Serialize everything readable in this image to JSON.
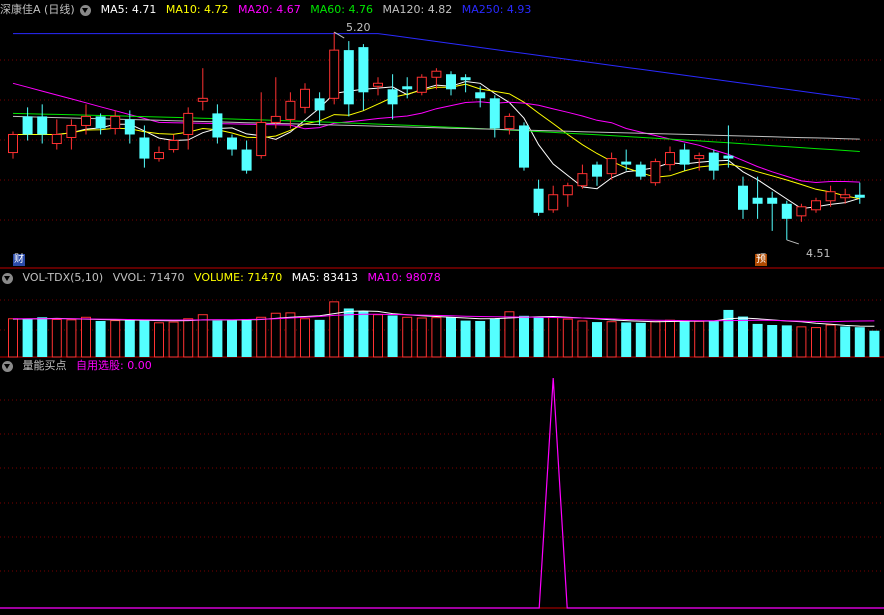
{
  "colors": {
    "up": "#ff3232",
    "down": "#54ffff",
    "ma5": "#ffffff",
    "ma10": "#ffff00",
    "ma20": "#ff00ff",
    "ma60": "#00e600",
    "ma120": "#c0c0c0",
    "ma250": "#2a2aff",
    "grid": "#7a0000",
    "signal": "#ff00ff"
  },
  "header": {
    "title": "深康佳A (日线)",
    "ma5": "MA5: 4.71",
    "ma10": "MA10: 4.72",
    "ma20": "MA20: 4.67",
    "ma60": "MA60: 4.76",
    "ma120": "MA120: 4.82",
    "ma250": "MA250: 4.93"
  },
  "vol_header": {
    "name": "VOL-TDX(5,10)",
    "vvol": "VVOL: 71470",
    "volume": "VOLUME: 71470",
    "ma5": "MA5: 83413",
    "ma10": "MA10: 98078"
  },
  "ind_header": {
    "name": "量能买点",
    "label": "自用选股: 0.00"
  },
  "markers": {
    "high_label": "5.20",
    "low_label": "4.51",
    "tag_cai": "财",
    "tag_yu": "预"
  },
  "chart_data": {
    "type": "candlestick",
    "price_range": [
      4.45,
      5.24
    ],
    "high_point": 5.2,
    "low_point": 4.51,
    "candles": [
      [
        4.8,
        4.86,
        4.78,
        4.87
      ],
      [
        4.92,
        4.86,
        4.84,
        4.95
      ],
      [
        4.92,
        4.86,
        4.83,
        4.96
      ],
      [
        4.83,
        4.86,
        4.81,
        4.91
      ],
      [
        4.85,
        4.89,
        4.81,
        4.91
      ],
      [
        4.89,
        4.92,
        4.86,
        4.96
      ],
      [
        4.92,
        4.88,
        4.86,
        4.93
      ],
      [
        4.88,
        4.92,
        4.86,
        4.94
      ],
      [
        4.91,
        4.86,
        4.83,
        4.94
      ],
      [
        4.85,
        4.78,
        4.75,
        4.89
      ],
      [
        4.78,
        4.8,
        4.77,
        4.82
      ],
      [
        4.81,
        4.84,
        4.8,
        4.86
      ],
      [
        4.86,
        4.93,
        4.81,
        4.95
      ],
      [
        4.97,
        4.98,
        4.94,
        5.08
      ],
      [
        4.93,
        4.85,
        4.83,
        4.96
      ],
      [
        4.85,
        4.81,
        4.79,
        4.86
      ],
      [
        4.81,
        4.74,
        4.73,
        4.84
      ],
      [
        4.79,
        4.9,
        4.78,
        5.0
      ],
      [
        4.9,
        4.92,
        4.88,
        5.05
      ],
      [
        4.91,
        4.97,
        4.88,
        5.0
      ],
      [
        4.95,
        5.01,
        4.93,
        5.03
      ],
      [
        4.98,
        4.94,
        4.89,
        5.0
      ],
      [
        4.98,
        5.14,
        4.96,
        5.2
      ],
      [
        5.14,
        4.96,
        4.92,
        5.17
      ],
      [
        5.15,
        5.0,
        4.94,
        5.16
      ],
      [
        5.02,
        5.03,
        4.99,
        5.05
      ],
      [
        5.01,
        4.96,
        4.91,
        5.06
      ],
      [
        5.02,
        5.01,
        4.98,
        5.05
      ],
      [
        5.0,
        5.05,
        4.99,
        5.06
      ],
      [
        5.05,
        5.07,
        5.01,
        5.08
      ],
      [
        5.06,
        5.01,
        4.99,
        5.07
      ],
      [
        5.05,
        5.04,
        5.0,
        5.06
      ],
      [
        5.0,
        4.98,
        4.95,
        5.02
      ],
      [
        4.98,
        4.88,
        4.85,
        4.99
      ],
      [
        4.88,
        4.92,
        4.86,
        4.93
      ],
      [
        4.89,
        4.75,
        4.74,
        4.9
      ],
      [
        4.68,
        4.6,
        4.59,
        4.71
      ],
      [
        4.61,
        4.66,
        4.6,
        4.69
      ],
      [
        4.66,
        4.69,
        4.62,
        4.7
      ],
      [
        4.69,
        4.73,
        4.68,
        4.76
      ],
      [
        4.76,
        4.72,
        4.69,
        4.77
      ],
      [
        4.73,
        4.78,
        4.71,
        4.8
      ],
      [
        4.77,
        4.76,
        4.74,
        4.81
      ],
      [
        4.76,
        4.72,
        4.71,
        4.77
      ],
      [
        4.7,
        4.77,
        4.69,
        4.78
      ],
      [
        4.76,
        4.8,
        4.74,
        4.82
      ],
      [
        4.81,
        4.76,
        4.74,
        4.83
      ],
      [
        4.78,
        4.79,
        4.74,
        4.8
      ],
      [
        4.8,
        4.74,
        4.71,
        4.81
      ],
      [
        4.79,
        4.78,
        4.75,
        4.89
      ],
      [
        4.69,
        4.61,
        4.58,
        4.72
      ],
      [
        4.65,
        4.63,
        4.58,
        4.72
      ],
      [
        4.65,
        4.63,
        4.54,
        4.67
      ],
      [
        4.63,
        4.58,
        4.51,
        4.64
      ],
      [
        4.59,
        4.62,
        4.57,
        4.63
      ],
      [
        4.61,
        4.64,
        4.6,
        4.65
      ],
      [
        4.64,
        4.67,
        4.62,
        4.69
      ],
      [
        4.65,
        4.66,
        4.63,
        4.68
      ],
      [
        4.66,
        4.65,
        4.63,
        4.7
      ]
    ],
    "volumes": [
      104000,
      103000,
      108000,
      102000,
      101000,
      108000,
      98000,
      99000,
      100000,
      101000,
      93000,
      95000,
      104000,
      115000,
      99000,
      100000,
      103000,
      108000,
      119000,
      120000,
      104000,
      101000,
      150000,
      132000,
      125000,
      115000,
      113000,
      108000,
      106000,
      107000,
      108000,
      99000,
      98000,
      105000,
      123000,
      112000,
      109000,
      108000,
      103000,
      98000,
      95000,
      96000,
      94000,
      93000,
      96000,
      100000,
      98000,
      97000,
      99000,
      128000,
      110000,
      90000,
      87000,
      86000,
      82000,
      80000,
      87000,
      83000,
      81000,
      71470
    ],
    "vol_up": [
      1,
      0,
      0,
      1,
      1,
      1,
      0,
      1,
      0,
      0,
      1,
      1,
      1,
      1,
      0,
      0,
      0,
      1,
      1,
      1,
      1,
      0,
      1,
      0,
      0,
      1,
      0,
      1,
      1,
      1,
      0,
      0,
      0,
      0,
      1,
      0,
      0,
      1,
      1,
      1,
      0,
      1,
      0,
      0,
      1,
      1,
      0,
      1,
      0,
      0,
      0,
      0,
      0,
      0,
      1,
      1,
      1,
      0,
      0,
      0
    ],
    "vol_ma5": [
      103000,
      103500,
      104000,
      105000,
      104000,
      103000,
      102000,
      101000,
      100500,
      100000,
      99000,
      98500,
      99000,
      101000,
      101000,
      100500,
      101000,
      102000,
      105000,
      108000,
      110000,
      112000,
      118000,
      124000,
      125000,
      124000,
      118000,
      115000,
      112000,
      110000,
      108000,
      106000,
      104000,
      104500,
      106000,
      108000,
      109500,
      110000,
      108000,
      106000,
      104000,
      101000,
      99000,
      97000,
      96000,
      96500,
      97000,
      97500,
      98000,
      104000,
      106000,
      104000,
      101000,
      98000,
      96000,
      92000,
      89000,
      86000,
      84000,
      83413
    ],
    "vol_ma10": [
      104000,
      104000,
      104000,
      104000,
      104000,
      103500,
      103000,
      102500,
      102000,
      101500,
      101000,
      100500,
      100500,
      101000,
      101500,
      101500,
      102000,
      102500,
      104000,
      106000,
      108000,
      110000,
      113000,
      115000,
      116000,
      116000,
      115500,
      115000,
      114000,
      113000,
      112000,
      111000,
      110000,
      109500,
      109000,
      108500,
      108000,
      107500,
      107000,
      106000,
      105000,
      103500,
      102000,
      101000,
      100000,
      99500,
      99000,
      98500,
      98500,
      99000,
      99500,
      100000,
      99500,
      98500,
      97500,
      96500,
      96000,
      97000,
      98000,
      98078
    ],
    "signal_index": 37,
    "signal_value": 1
  }
}
